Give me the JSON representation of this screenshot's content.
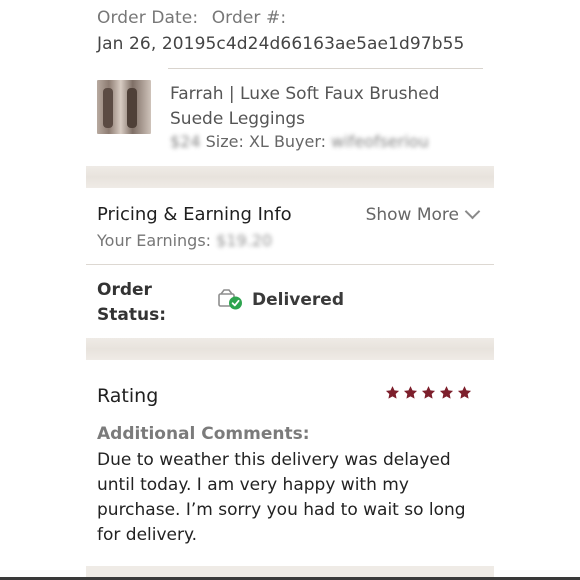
{
  "order": {
    "date_label": "Order Date:",
    "number_label": "Order #:",
    "date_value": "Jan 26, 2019",
    "number_value": "5c4d24d66163ae5ae1d97b55"
  },
  "product": {
    "title": "Farrah | Luxe Soft Faux Brushed Suede Leggings",
    "price_obscured": "$24",
    "size": "Size: XL",
    "buyer_label": "Buyer:",
    "buyer_obscured": "wifeofseriou"
  },
  "pricing": {
    "title": "Pricing & Earning Info",
    "show_more": "Show More",
    "earnings_label": "Your Earnings:",
    "earnings_obscured": "$19.20"
  },
  "status": {
    "label": "Order Status:",
    "value": "Delivered",
    "icon": "package-delivered-icon",
    "check_color": "#2ea44f"
  },
  "rating": {
    "title": "Rating",
    "stars": 5,
    "star_color": "#7d1f2c",
    "comments_label": "Additional Comments:",
    "comments_text": "Due to weather this delivery was delayed until today. I am very happy with my purchase. I’m sorry you had to wait so long for delivery."
  }
}
